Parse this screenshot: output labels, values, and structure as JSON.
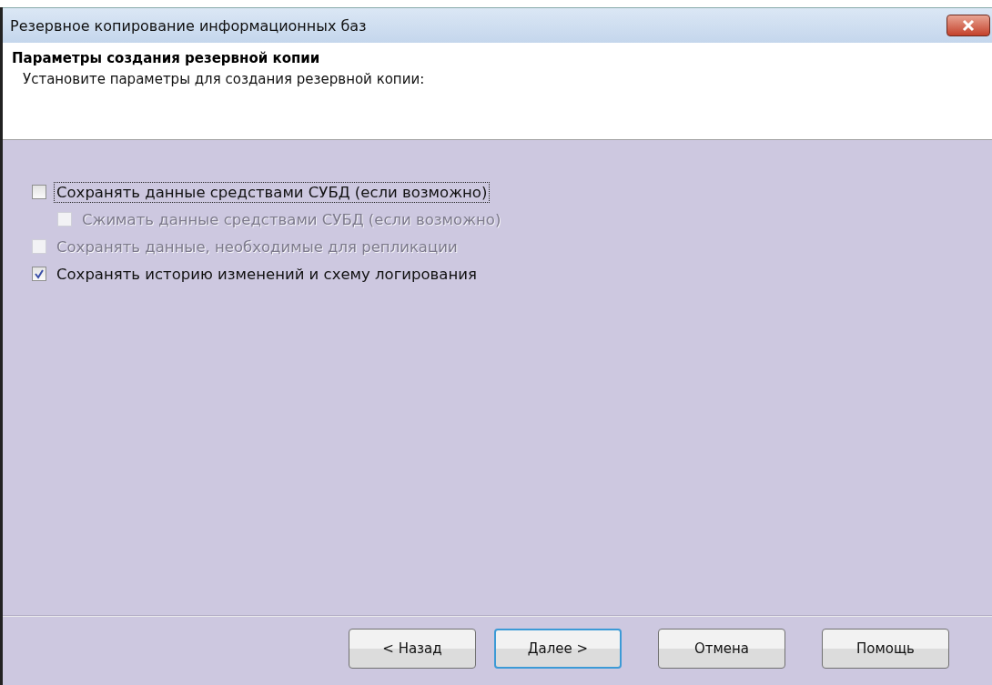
{
  "window": {
    "title": "Резервное копирование информационных баз"
  },
  "header": {
    "title": "Параметры создания резервной копии",
    "subtitle": "Установите параметры для создания резервной копии:"
  },
  "options": [
    {
      "label": "Сохранять данные средствами СУБД (если возможно)",
      "checked": false,
      "disabled": false,
      "focused": true,
      "children": [
        {
          "label": "Сжимать данные средствами СУБД (если возможно)",
          "checked": false,
          "disabled": true,
          "focused": false
        }
      ]
    },
    {
      "label": "Сохранять данные, необходимые для репликации",
      "checked": false,
      "disabled": true,
      "focused": false
    },
    {
      "label": "Сохранять историю изменений и схему логирования",
      "checked": true,
      "disabled": false,
      "focused": false
    }
  ],
  "buttons": [
    {
      "label": "< Назад",
      "default": false
    },
    {
      "label": "Далее >",
      "default": true
    },
    {
      "label": "Отмена",
      "default": false
    },
    {
      "label": "Помощь",
      "default": false
    }
  ]
}
